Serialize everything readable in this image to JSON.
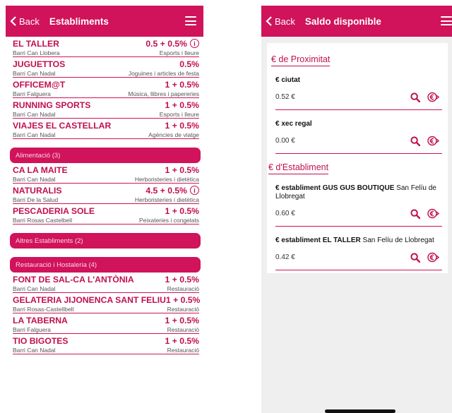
{
  "left": {
    "back_label": "Back",
    "title": "Establiments",
    "items_top": [
      {
        "name": "EL TALLER",
        "pct": "0.5 + 0.5%",
        "info": true,
        "area": "Barri Can Llobera",
        "category": "Esports i lleure"
      },
      {
        "name": "JUGUETTOS",
        "pct": "0.5%",
        "info": false,
        "area": "Barri Can Nadal",
        "category": "Joguines i articles de festa"
      },
      {
        "name": "OFFICEM@T",
        "pct": "1 + 0.5%",
        "info": false,
        "area": "Barri Falguera",
        "category": "Música, llibres i papereries"
      },
      {
        "name": "RUNNING SPORTS",
        "pct": "1 + 0.5%",
        "info": false,
        "area": "Barri Can Nadal",
        "category": "Esports i lleure"
      },
      {
        "name": "VIAJES EL CASTELLAR",
        "pct": "1 + 0.5%",
        "info": false,
        "area": "Barri Can Nadal",
        "category": "Agències de viatge"
      }
    ],
    "cat_alimentacio": "Alimentació (3)",
    "items_alim": [
      {
        "name": "CA LA MAITE",
        "pct": "1 + 0.5%",
        "info": false,
        "area": "Barri Can Nadal",
        "category": "Herboristeries i dietètica"
      },
      {
        "name": "NATURALIS",
        "pct": "4.5 + 0.5%",
        "info": true,
        "area": "Barri De la Salud",
        "category": "Herboristeries i dietètica"
      },
      {
        "name": "PESCADERIA SOLE",
        "pct": "1 + 0.5%",
        "info": false,
        "area": "Barri Rosas Castelbell",
        "category": "Peixateries i congelats"
      }
    ],
    "cat_altres": "Altres Establiments (2)",
    "cat_restauracio": "Restauració i Hostaleria (4)",
    "items_rest": [
      {
        "name": "FONT DE SAL-CA L'ANTÒNIA",
        "pct": "1 + 0.5%",
        "info": false,
        "area": "Barri Can Nadal",
        "category": "Restauració"
      },
      {
        "name": "GELATERIA JIJONENCA SANT FELIU",
        "pct": "1 + 0.5%",
        "info": false,
        "area": "Barri Rosas-Castellbell",
        "category": "Restauració"
      },
      {
        "name": "LA TABERNA",
        "pct": "1 + 0.5%",
        "info": false,
        "area": "Barri Falguera",
        "category": "Restauració"
      },
      {
        "name": "TIO BIGOTES",
        "pct": "1 + 0.5%",
        "info": false,
        "area": "Barri Can Nadal",
        "category": "Restauració"
      }
    ]
  },
  "right": {
    "back_label": "Back",
    "title": "Saldo disponible",
    "section1_title": "€ de Proximitat",
    "section1_cards": [
      {
        "name_bold": "€ ciutat",
        "name_rest": "",
        "amount": "0.52 €"
      },
      {
        "name_bold": "€ xec regal",
        "name_rest": "",
        "amount": "0.00 €"
      }
    ],
    "section2_title": "€ d'Establiment",
    "section2_cards": [
      {
        "name_bold": "€ establiment GUS GUS BOUTIQUE",
        "name_rest": " San Felíu de Llobregat",
        "amount": "0.60 €"
      },
      {
        "name_bold": "€ establiment EL TALLER",
        "name_rest": " San Felíu de Llobregat",
        "amount": "0.42 €"
      }
    ]
  },
  "colors": {
    "accent": "#d0135a",
    "accent_text": "#c10f50"
  }
}
